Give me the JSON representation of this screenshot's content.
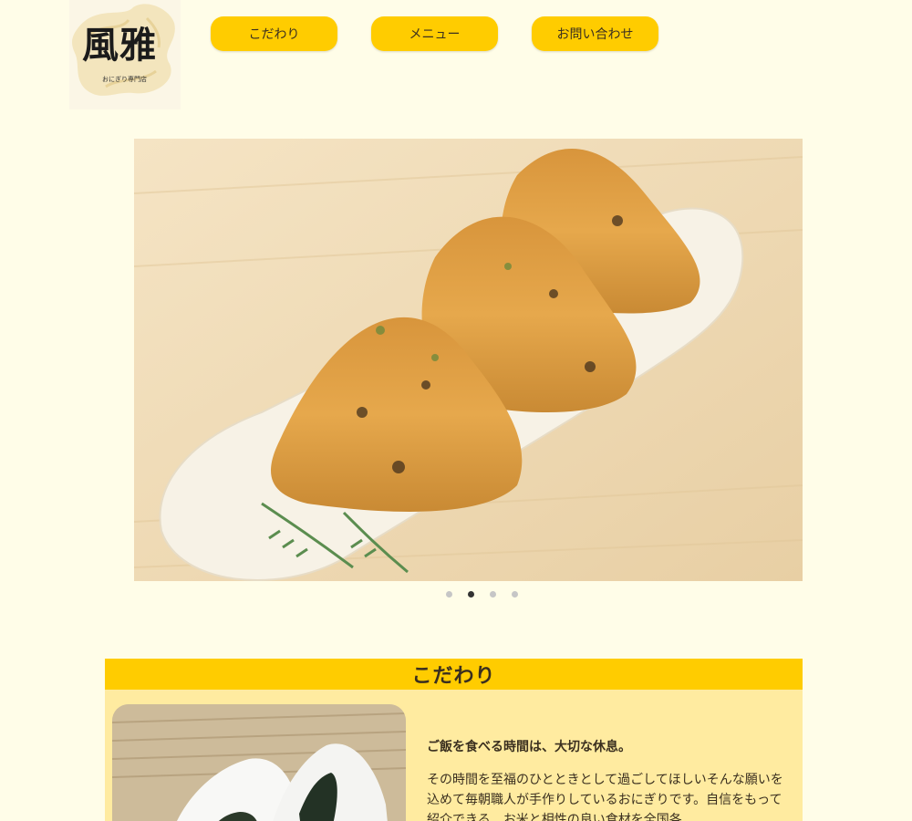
{
  "header": {
    "logo": {
      "text": "風雅",
      "subtitle": "おにぎり専門店"
    },
    "nav": [
      {
        "label": "こだわり"
      },
      {
        "label": "メニュー"
      },
      {
        "label": "お問い合わせ"
      }
    ]
  },
  "hero": {
    "image": "grilled-onigiri-photo",
    "slider": {
      "count": 4,
      "active_index": 1
    }
  },
  "section": {
    "title": "こだわり",
    "image": "onigiri-with-nori-photo",
    "lead": "ご飯を食べる時間は、大切な休息。",
    "paragraph": "その時間を至福のひとときとして過ごしてほしいそんな願いを込めて毎朝職人が手作りしているおにぎりです。自信をもって紹介できる、お米と相性の良い食材を全国各"
  },
  "colors": {
    "background": "#fffde8",
    "accent": "#ffcc00",
    "section_body": "#ffeba0"
  }
}
